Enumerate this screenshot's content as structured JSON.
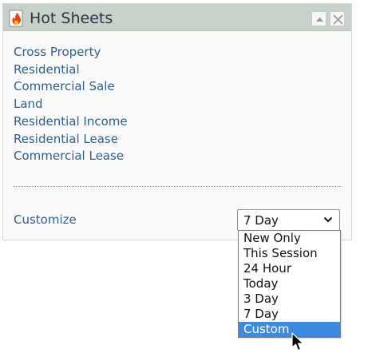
{
  "widget": {
    "title": "Hot Sheets",
    "icon": "fire-sheet-icon",
    "collapse_icon": "triangle-up-icon",
    "close_icon": "close-icon"
  },
  "links": [
    "Cross Property",
    "Residential",
    "Commercial Sale",
    "Land",
    "Residential Income",
    "Residential Lease",
    "Commercial Lease"
  ],
  "customize": {
    "label": "Customize",
    "select_value": "7 Day",
    "options": [
      "New Only",
      "This Session",
      "24 Hour",
      "Today",
      "3 Day",
      "7 Day",
      "Custom"
    ],
    "highlighted_option": "Custom"
  },
  "colors": {
    "header_bg": "#c7d1ca",
    "link": "#2f5f8f",
    "highlight": "#3c8ae2"
  }
}
